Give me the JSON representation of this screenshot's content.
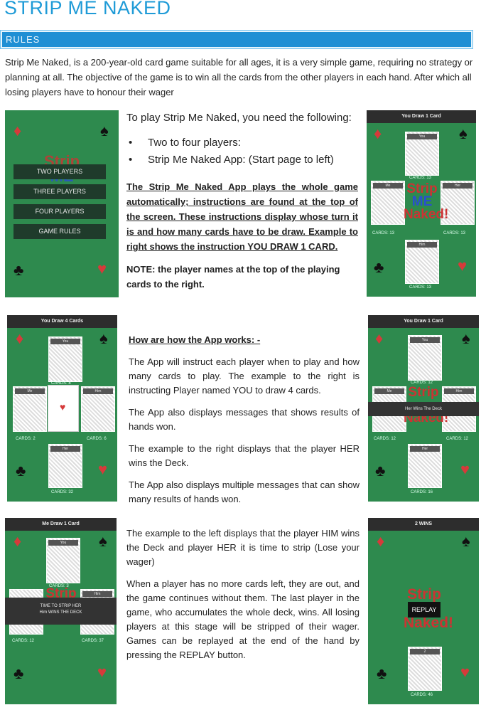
{
  "title": "STRIP ME NAKED",
  "section": "RULES",
  "intro": "Strip Me Naked, is a 200-year-old card game suitable for all ages, it is a very simple game, requiring no strategy or planning at all. The objective of the game is to win all the cards from the other players in each hand. After which all losing players have to honour their wager",
  "play_heading": "To play Strip Me Naked, you need the following:",
  "requirements": [
    "Two to four players:",
    "Strip Me Naked App: (Start page to left)"
  ],
  "auto_note": "The Strip Me Naked App plays the whole game automatically; instructions are found at the top of the screen. These instructions display whose turn it is and how many cards have to be draw. Example to right shows the instruction YOU DRAW 1 CARD.",
  "note": "NOTE: the player names at the top of the playing cards to the right.",
  "how_heading": "How are how the App works: -",
  "paragraphs": [
    "The App will instruct each player when to play and how many cards to play. The example to the right is instructing Player named YOU to draw 4 cards.",
    "The App also displays messages that shows results of hands won.",
    "The example to the right displays that the player HER wins the Deck.",
    "The App also displays multiple messages that can show many results of hands won.",
    "The example to the left displays that the player HIM wins the Deck and player HER it is time to strip (Lose your wager)",
    "When a player has no more cards left, they are out, and the game continues without them. The last player in the game, who accumulates the whole deck, wins. All losing players at this stage will be stripped of their wager. Games can be replayed at the end of the hand by pressing the REPLAY button."
  ],
  "menu": [
    "TWO PLAYERS",
    "THREE PLAYERS",
    "FOUR PLAYERS",
    "GAME RULES"
  ],
  "logo": [
    "Strip",
    "ME",
    "Naked!"
  ],
  "shot1": {
    "bar": "You Draw 1 Card",
    "you": "You",
    "me": "Me",
    "her": "Her",
    "him": "Him",
    "c_top": "CARDS: 13",
    "c_left": "CARDS: 13",
    "c_right": "CARDS: 13",
    "c_bot": "CARDS: 13"
  },
  "shot2": {
    "bar": "You Draw 4 Cards",
    "you": "You",
    "me": "Me",
    "him": "Him",
    "her": "Her",
    "c_top": "CARDS: 8",
    "c_left": "CARDS: 2",
    "c_right": "CARDS: 6",
    "c_bot": "CARDS: 32"
  },
  "shot3": {
    "bar": "You Draw 1 Card",
    "you": "You",
    "me": "Me",
    "him": "Him",
    "her": "Her",
    "c_top": "CARDS: 12",
    "c_left": "CARDS: 12",
    "c_right": "CARDS: 12",
    "c_bot": "CARDS: 16",
    "msg": "Her Wins The Deck"
  },
  "shot4": {
    "bar": "Me Draw 1 Card",
    "you": "You",
    "him": "Him",
    "c_top": "CARDS: 3",
    "c_left": "CARDS: 12",
    "c_right": "CARDS: 37",
    "msg1": "TIME TO STRIP HER",
    "msg2": "Him WINS THE DECK"
  },
  "shot5": {
    "bar": "2 WINS",
    "replay": "REPLAY",
    "card": "2",
    "c_bot": "CARDS: 46"
  }
}
